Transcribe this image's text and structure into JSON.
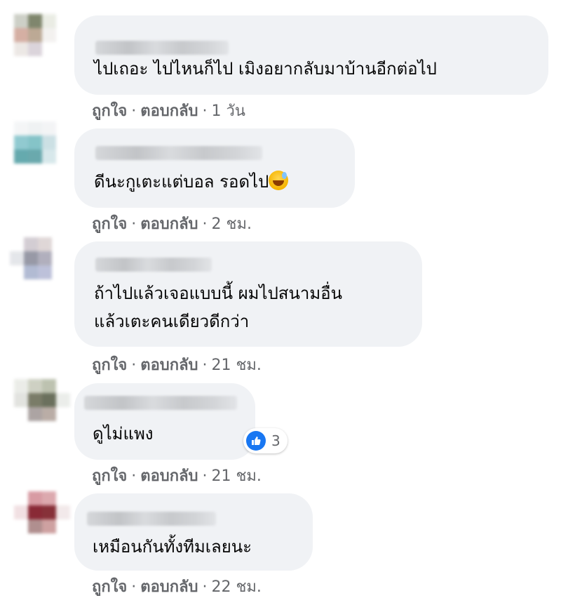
{
  "comments": [
    {
      "text_lines": [
        "ไปเถอะ ไปไหนก็ไป เมิงอยากลับมาบ้านอีกต่อไป"
      ],
      "like_label": "ถูกใจ",
      "reply_label": "ตอบกลับ",
      "separator": "·",
      "time": "1 วัน",
      "avatar_colors": [
        "#c8cbc1",
        "#727a5e",
        "#e8ebe2",
        "#ffffff",
        "#d1a79a",
        "#b5a08a",
        "#f2f0ee",
        "#ffffff",
        "#ebe6e3",
        "#d8d0d8",
        "#ffffff",
        "#ffffff",
        "#ffffff",
        "#ffffff",
        "#ffffff",
        "#ffffff"
      ]
    },
    {
      "text_lines": [
        "ดีนะกูเตะแต่บอล รอดไป"
      ],
      "emoji": "grinning-sweat-emoji",
      "like_label": "ถูกใจ",
      "reply_label": "ตอบกลับ",
      "separator": "·",
      "time": "2 ชม.",
      "avatar_colors": [
        "#f3f5f6",
        "#eef1f2",
        "#f2f3f5",
        "#ffffff",
        "#86c5cc",
        "#78bec3",
        "#c7dde2",
        "#ffffff",
        "#55a1a6",
        "#5aa0a5",
        "#d3e6e9",
        "#ffffff",
        "#ffffff",
        "#ffffff",
        "#ffffff",
        "#ffffff"
      ]
    },
    {
      "text_lines": [
        "ถ้าไปแล้วเจอแบบนี้ ผมไปสนามอื่น",
        "แล้วเตะคนเดียวดีกว่า"
      ],
      "like_label": "ถูกใจ",
      "reply_label": "ตอบกลับ",
      "separator": "·",
      "time": "21 ชม.",
      "avatar_colors": [
        "#ffffff",
        "#cfc8cf",
        "#dcd3d3",
        "#ffffff",
        "#e2e4e8",
        "#8d8f9d",
        "#a9a7b6",
        "#ffffff",
        "#ffffff",
        "#aab4cf",
        "#b6bbd6",
        "#ffffff",
        "#ffffff",
        "#ffffff",
        "#ffffff",
        "#ffffff"
      ]
    },
    {
      "text_lines": [
        "ดูไม่แพง"
      ],
      "like_label": "ถูกใจ",
      "reply_label": "ตอบกลับ",
      "separator": "·",
      "time": "21 ชม.",
      "reaction_count": "3",
      "avatar_colors": [
        "#e9ebe6",
        "#c9ccbd",
        "#b6bca8",
        "#ffffff",
        "#dfe0dc",
        "#6c6e58",
        "#5b614c",
        "#e9ece8",
        "#ffffff",
        "#a49b9a",
        "#b3a59d",
        "#ffffff",
        "#ffffff",
        "#ffffff",
        "#ffffff",
        "#ffffff"
      ]
    },
    {
      "text_lines": [
        "เหมือนกันทั้งทีมเลยนะ"
      ],
      "like_label": "ถูกใจ",
      "reply_label": "ตอบกลับ",
      "separator": "·",
      "time": "22 ชม.",
      "avatar_colors": [
        "#ffffff",
        "#d4919a",
        "#d9a0a6",
        "#ffffff",
        "#f0dde0",
        "#7d1321",
        "#7b1b24",
        "#f1e7e8",
        "#ffffff",
        "#a88383",
        "#c99797",
        "#ffffff",
        "#ffffff",
        "#ffffff",
        "#ffffff",
        "#ffffff"
      ]
    }
  ],
  "colors": {
    "bubble_bg": "#f0f2f5",
    "meta_text": "#65676b",
    "like_blue": "#1877f2"
  },
  "icons": {
    "reaction": "like-thumb-icon"
  }
}
